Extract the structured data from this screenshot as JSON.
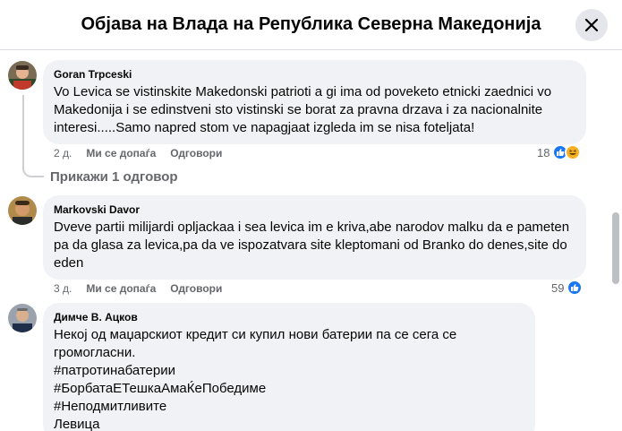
{
  "header": {
    "title": "Објава на Влада на Република Северна Македонија"
  },
  "comments": [
    {
      "author": "Goran Trpceski",
      "lines": [
        "Vo Levica se vistinskite Makedonski patrioti a gi ima od poveketo etnicki zaednici vo",
        "Makedonija i se edinstveni sto vistinski se borat za pravna drzava i za nacionalnite",
        "interesi.....Samo napred stom ve napagjaat izgleda im se nisa foteljata!"
      ],
      "time": "2 д.",
      "like_label": "Ми се допаѓа",
      "reply_label": "Одговори",
      "reaction_count": "18",
      "reactions": [
        "like-icon",
        "haha-icon"
      ],
      "replies_link": "Прикажи 1 одговор"
    },
    {
      "author": "Markovski Davor",
      "lines": [
        "Dveve partii milijardi opljackaa i sea levica im e kriva,abe narodov malku da e pameten",
        "pa da glasa za levica,pa da ve ispozatvara site kleptomani od Branko do denes,site do",
        "eden"
      ],
      "time": "3 д.",
      "like_label": "Ми се допаѓа",
      "reply_label": "Одговори",
      "reaction_count": "59",
      "reactions": [
        "like-icon"
      ]
    },
    {
      "author": "Димче В. Ацков",
      "lines": [
        "Некој од мaџарскиот кредит си купил нови батерии па се сега се громогласни.",
        "#патротинабатерии",
        "#БорбатаЕТешкаАмаЌеПобедиме",
        "#Неподмитливите",
        "Левица"
      ]
    }
  ]
}
